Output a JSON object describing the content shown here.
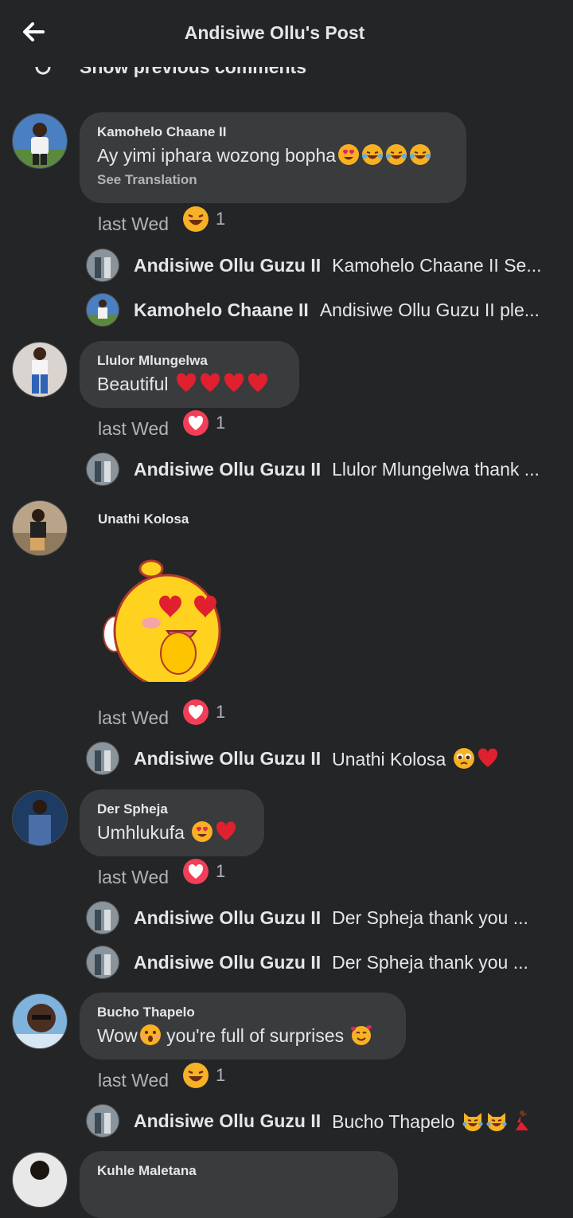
{
  "header": {
    "title": "Andisiwe Ollu's Post"
  },
  "show_previous": "Show previous comments",
  "comments": [
    {
      "name": "Kamohelo Chaane II",
      "text": "Ay yimi iphara wozong bopha",
      "emojis": [
        "heart-eyes",
        "laughing-tears",
        "laughing-tears",
        "laughing-tears"
      ],
      "see_translation": "See Translation",
      "time": "last Wed",
      "reaction": "haha",
      "count": "1"
    },
    {
      "name": "Llulor Mlungelwa",
      "text": "Beautiful",
      "emojis": [
        "red-heart",
        "red-heart",
        "red-heart",
        "red-heart"
      ],
      "time": "last Wed",
      "reaction": "love",
      "count": "1"
    },
    {
      "name": "Unathi Kolosa",
      "text": "",
      "sticker": "heart-eyes-chick-sticker",
      "time": "last Wed",
      "reaction": "love",
      "count": "1"
    },
    {
      "name": "Der Spheja",
      "text": "Umhlukufa",
      "emojis": [
        "heart-eyes",
        "red-heart"
      ],
      "time": "last Wed",
      "reaction": "love",
      "count": "1"
    },
    {
      "name": "Bucho Thapelo",
      "text_a": "Wow",
      "text_b": " you're full of surprises ",
      "emojis": [
        "hushed-face",
        "smiling-hearts"
      ],
      "time": "last Wed",
      "reaction": "haha",
      "count": "1"
    },
    {
      "name": "Kuhle Maletana"
    }
  ],
  "replies": [
    {
      "name": "Andisiwe Ollu Guzu II",
      "text": "Kamohelo Chaane II Se..."
    },
    {
      "name": "Kamohelo Chaane II",
      "text": "Andisiwe Ollu Guzu II ple..."
    },
    {
      "name": "Andisiwe Ollu Guzu II",
      "text": "Llulor Mlungelwa thank ..."
    },
    {
      "name": "Andisiwe Ollu Guzu II",
      "text": "Unathi Kolosa",
      "emojis": [
        "pleading-face",
        "red-heart"
      ]
    },
    {
      "name": "Andisiwe Ollu Guzu II",
      "text": "Der Spheja thank you ..."
    },
    {
      "name": "Andisiwe Ollu Guzu II",
      "text": "Der Spheja thank you ..."
    },
    {
      "name": "Andisiwe Ollu Guzu II",
      "text": "Bucho Thapelo",
      "emojis": [
        "crying-cat",
        "crying-cat",
        "dancer"
      ]
    }
  ],
  "colors": {
    "background": "#242526",
    "bubble": "#3a3b3c",
    "secondary_text": "#b0b3b8",
    "love": "#f33e58",
    "haha": "#f7b125"
  }
}
